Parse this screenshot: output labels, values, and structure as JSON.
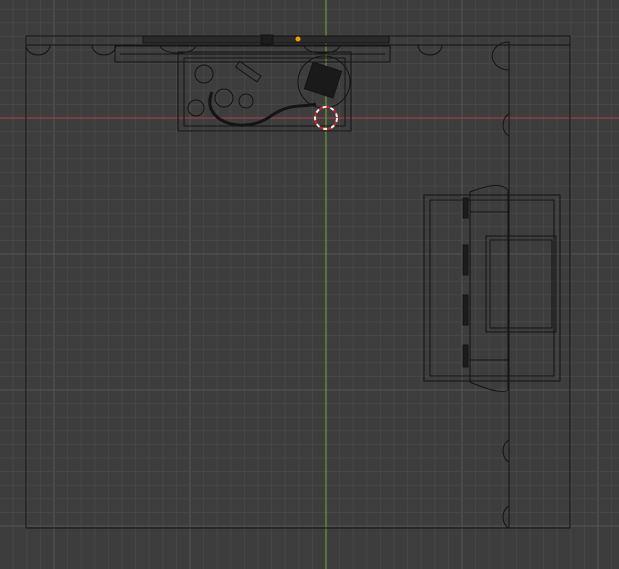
{
  "viewport": {
    "view": "top-orthographic",
    "mode": "wireframe",
    "colors": {
      "background": "#3d3d3d",
      "grid_minor": "#474747",
      "grid_major": "#555555",
      "x_axis": "#9a3e48",
      "y_axis": "#6e9a2a",
      "wire": "#141414",
      "wire_light": "#2a2a2a",
      "origin": "#f0a000",
      "cursor_red": "#d02020",
      "cursor_white": "#f0f0f0"
    }
  },
  "objects": [
    {
      "name": "room-floor"
    },
    {
      "name": "wall-shelf"
    },
    {
      "name": "desk"
    },
    {
      "name": "bed"
    },
    {
      "name": "wall-lamps"
    }
  ]
}
